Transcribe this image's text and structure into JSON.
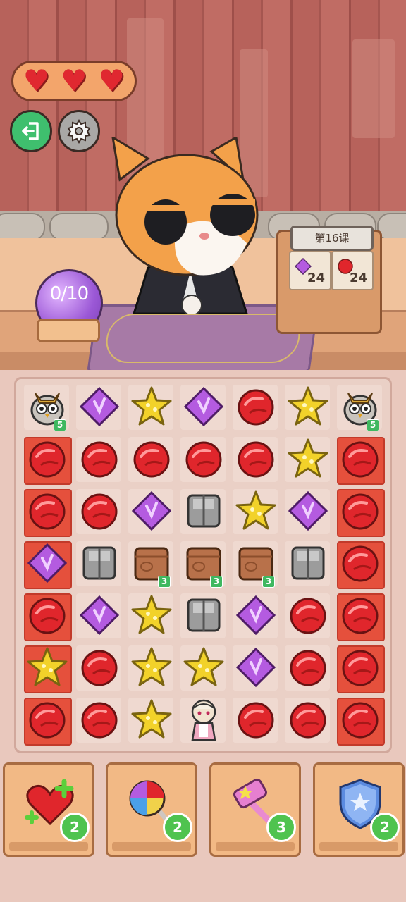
{
  "hud": {
    "lives": 3,
    "heart_glyph": "♥",
    "exit_icon": "exit-icon",
    "settings_icon": "gear-icon"
  },
  "objective": {
    "orb_progress": "0/10",
    "level_title": "第16课",
    "goals": [
      {
        "gem": "purple",
        "count": "24"
      },
      {
        "gem": "red",
        "count": "24"
      }
    ]
  },
  "board": {
    "rows": [
      [
        {
          "t": "owl",
          "b": "5"
        },
        {
          "t": "purple"
        },
        {
          "t": "yellow"
        },
        {
          "t": "purple"
        },
        {
          "t": "red"
        },
        {
          "t": "yellow"
        },
        {
          "t": "owl",
          "b": "5"
        }
      ],
      [
        {
          "t": "red",
          "j": 1
        },
        {
          "t": "red"
        },
        {
          "t": "red"
        },
        {
          "t": "red"
        },
        {
          "t": "red"
        },
        {
          "t": "yellow"
        },
        {
          "t": "red",
          "j": 1
        }
      ],
      [
        {
          "t": "red",
          "j": 1
        },
        {
          "t": "red"
        },
        {
          "t": "purple"
        },
        {
          "t": "metal"
        },
        {
          "t": "yellow"
        },
        {
          "t": "purple"
        },
        {
          "t": "red",
          "j": 1
        }
      ],
      [
        {
          "t": "purple",
          "j": 1
        },
        {
          "t": "metal"
        },
        {
          "t": "wood",
          "b": "3"
        },
        {
          "t": "wood",
          "b": "3"
        },
        {
          "t": "wood",
          "b": "3"
        },
        {
          "t": "metal"
        },
        {
          "t": "red",
          "j": 1
        }
      ],
      [
        {
          "t": "red",
          "j": 1
        },
        {
          "t": "purple"
        },
        {
          "t": "yellow"
        },
        {
          "t": "metal"
        },
        {
          "t": "purple"
        },
        {
          "t": "red"
        },
        {
          "t": "red",
          "j": 1
        }
      ],
      [
        {
          "t": "yellow",
          "j": 1
        },
        {
          "t": "red"
        },
        {
          "t": "yellow"
        },
        {
          "t": "yellow"
        },
        {
          "t": "purple"
        },
        {
          "t": "red"
        },
        {
          "t": "red",
          "j": 1
        }
      ],
      [
        {
          "t": "red",
          "j": 1
        },
        {
          "t": "red"
        },
        {
          "t": "yellow"
        },
        {
          "t": "maid"
        },
        {
          "t": "red"
        },
        {
          "t": "red"
        },
        {
          "t": "red",
          "j": 1
        }
      ]
    ]
  },
  "boosters": [
    {
      "name": "heart-plus",
      "count": "2"
    },
    {
      "name": "lollipop",
      "count": "2"
    },
    {
      "name": "hammer",
      "count": "3"
    },
    {
      "name": "shield",
      "count": "2"
    }
  ],
  "colors": {
    "red": "#e0262c",
    "purple": "#b45be0",
    "yellow": "#f2d22a",
    "metal": "#9c9c9c",
    "wood": "#b8714a",
    "jelly": "#e5503c"
  }
}
